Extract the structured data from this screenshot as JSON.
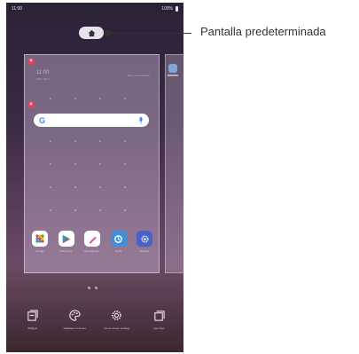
{
  "status_bar": {
    "time": "11:00",
    "battery": "100%"
  },
  "home_screen": {
    "clock_time": "11:00",
    "clock_date": "Mon, Jan 1",
    "weather_text": "Tap to add weather",
    "search_logo": "G",
    "dock_apps": [
      {
        "label": "Google",
        "icon": "google-folder-icon"
      },
      {
        "label": "Play Store",
        "icon": "play-store-icon"
      },
      {
        "label": "QuickMemo+",
        "icon": "quickmemo-icon"
      },
      {
        "label": "Tools",
        "icon": "tools-icon"
      },
      {
        "label": "Settings",
        "icon": "settings-icon"
      }
    ],
    "bottom_tools": [
      {
        "label": "Widgets",
        "icon": "widgets-icon"
      },
      {
        "label": "Wallpaper & theme",
        "icon": "palette-icon"
      },
      {
        "label": "Home screen settings",
        "icon": "gear-icon"
      },
      {
        "label": "App trays",
        "icon": "app-tray-icon"
      }
    ]
  },
  "callout": {
    "label": "Pantalla predeterminada"
  },
  "colors": {
    "accent_remove": "#e0435a",
    "callout": "#333333"
  }
}
